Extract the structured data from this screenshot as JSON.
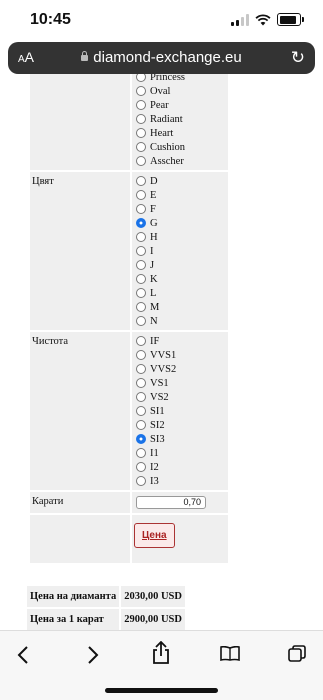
{
  "status": {
    "time": "10:45"
  },
  "urlbar": {
    "aa_small": "A",
    "aa_large": "A",
    "host": "diamond-exchange.eu"
  },
  "shape": {
    "options": [
      "Princess",
      "Oval",
      "Pear",
      "Radiant",
      "Heart",
      "Cushion",
      "Asscher"
    ]
  },
  "color": {
    "label": "Цвят",
    "options": [
      "D",
      "E",
      "F",
      "G",
      "H",
      "I",
      "J",
      "K",
      "L",
      "M",
      "N"
    ],
    "selected": "G"
  },
  "clarity": {
    "label": "Чистота",
    "options": [
      "IF",
      "VVS1",
      "VVS2",
      "VS1",
      "VS2",
      "SI1",
      "SI2",
      "SI3",
      "I1",
      "I2",
      "I3"
    ],
    "selected": "SI3"
  },
  "carats": {
    "label": "Карати",
    "value": "0,70"
  },
  "price_button": {
    "label": "Цена"
  },
  "summary": {
    "diamond_price_label": "Цена на диаманта",
    "diamond_price_value": "2030,00 USD",
    "per_carat_label": "Цена за 1 карат",
    "per_carat_value": "2900,00 USD"
  },
  "toolbar": {
    "back_icon": "chevron-left-icon",
    "forward_icon": "chevron-right-icon",
    "share_icon": "share-icon",
    "bookmarks_icon": "book-icon",
    "tabs_icon": "tabs-icon"
  }
}
